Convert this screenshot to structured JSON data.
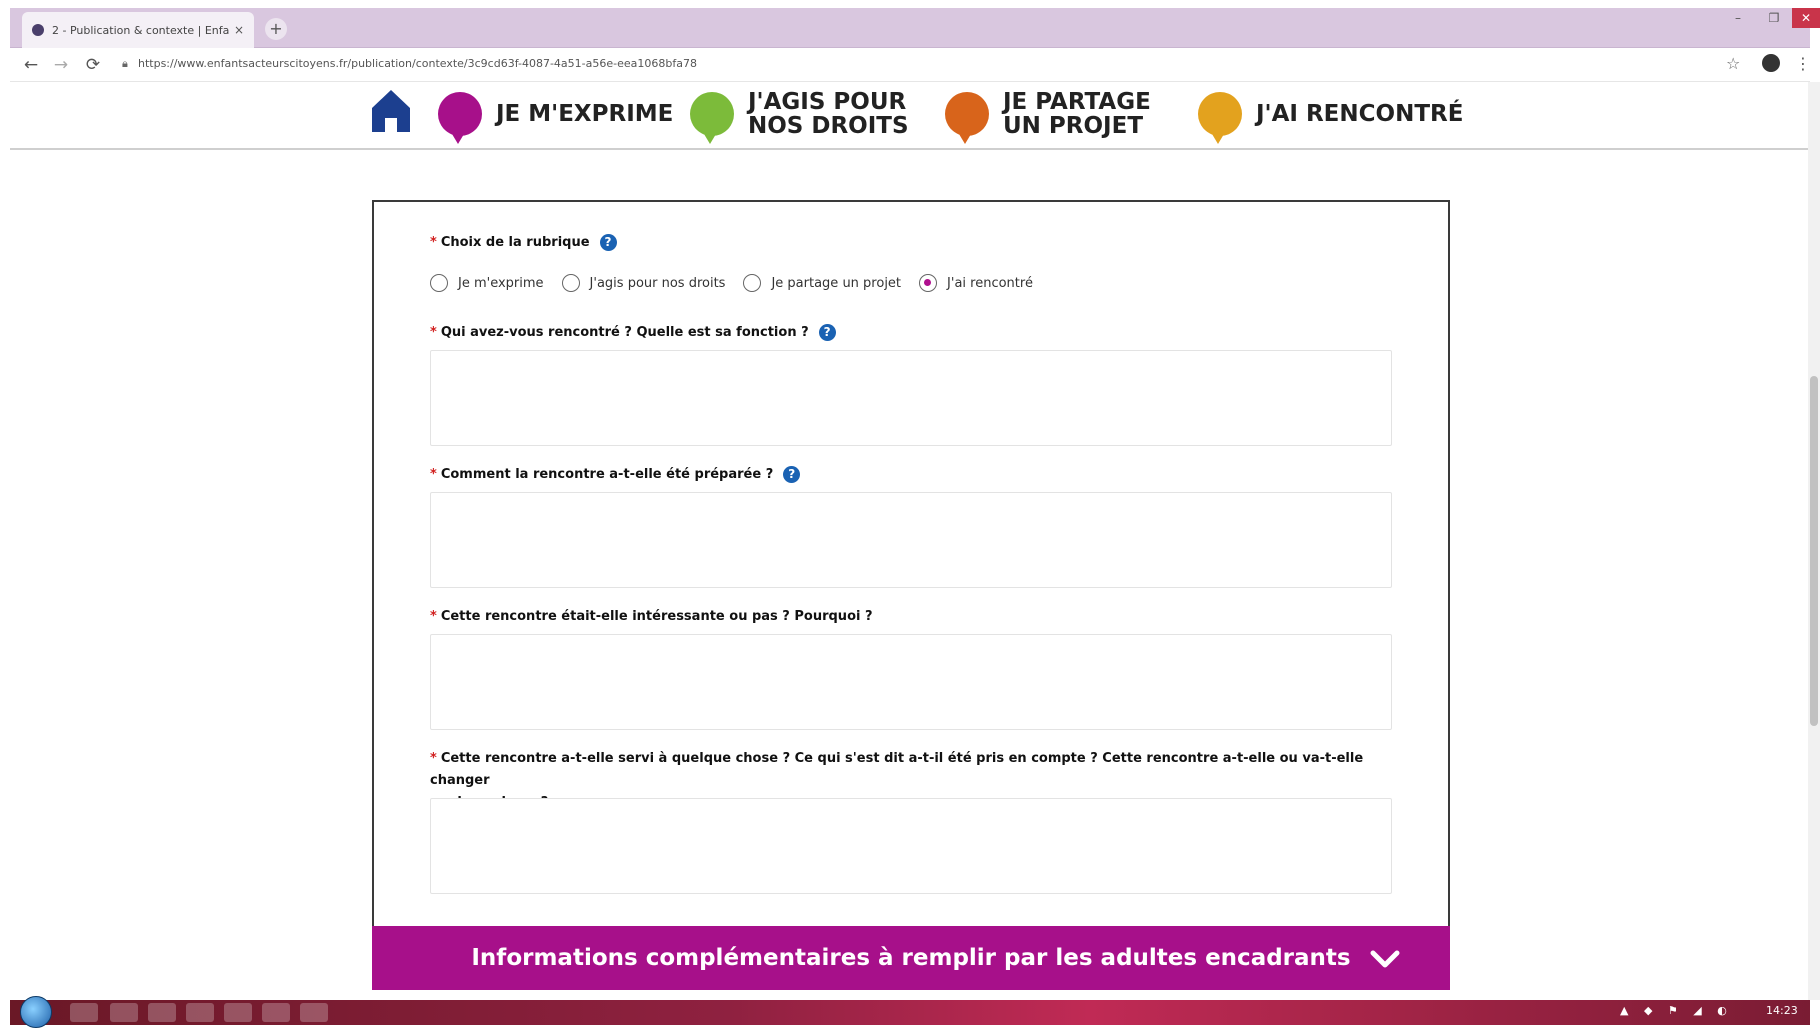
{
  "browser": {
    "tab_title": "2 - Publication & contexte | Enfa",
    "tab_close": "×",
    "new_tab": "+",
    "url": "https://www.enfantsacteurscitoyens.fr/publication/contexte/3c9cd63f-4087-4a51-a56e-eea1068bfa78",
    "window_min": "–",
    "window_max": "❐",
    "window_close": "✕"
  },
  "site_nav": {
    "items": [
      {
        "label_line1": "JE M'EXPRIME",
        "label_line2": "",
        "color": "#a7108a"
      },
      {
        "label_line1": "J'AGIS POUR",
        "label_line2": "NOS DROITS",
        "color": "#7cbb3a"
      },
      {
        "label_line1": "JE PARTAGE",
        "label_line2": "UN PROJET",
        "color": "#d8641b"
      },
      {
        "label_line1": "J'AI RENCONTRÉ",
        "label_line2": "",
        "color": "#e3a21e"
      }
    ],
    "home_color": "#1c3f8f"
  },
  "form": {
    "rubrique_label": "Choix de la rubrique",
    "required_mark": "*",
    "help_mark": "?",
    "radio_options": [
      "Je m'exprime",
      "J'agis pour nos droits",
      "Je partage un projet",
      "J'ai rencontré"
    ],
    "radio_selected": "J'ai rencontré",
    "q1": "Qui avez-vous rencontré ? Quelle est sa fonction ?",
    "q2": "Comment la rencontre a-t-elle été préparée ?",
    "q3": "Cette rencontre était-elle intéressante ou pas ? Pourquoi ?",
    "q4_line1": "Cette rencontre a-t-elle servi à quelque chose ? Ce qui s'est dit a-t-il été pris en compte ? Cette rencontre a-t-elle ou va-t-elle changer",
    "q4_line2": "quelque chose ?"
  },
  "footer_bar": {
    "label": "Informations complémentaires à remplir par les adultes encadrants",
    "color": "#a7108a"
  },
  "taskbar": {
    "clock": "14:23"
  },
  "icons": {
    "home": "home-icon",
    "help": "help-icon",
    "chevron": "chevron-down-icon"
  }
}
